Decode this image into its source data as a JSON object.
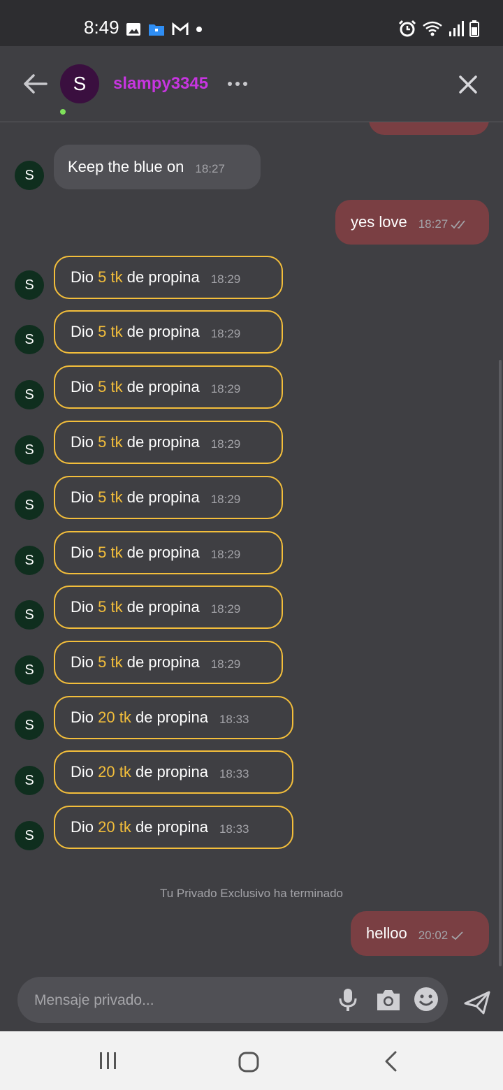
{
  "status_bar": {
    "time": "8:49"
  },
  "header": {
    "username": "slampy3345",
    "avatar_letter": "S"
  },
  "messages": [
    {
      "type": "in",
      "text": "Keep the blue on",
      "time": "18:27",
      "avatar": "S"
    },
    {
      "type": "out",
      "text": "yes love",
      "time": "18:27",
      "status": "read"
    },
    {
      "type": "tip",
      "prefix": "Dio",
      "amount": "5 tk",
      "suffix": "de propina",
      "time": "18:29",
      "avatar": "S"
    },
    {
      "type": "tip",
      "prefix": "Dio",
      "amount": "5 tk",
      "suffix": "de propina",
      "time": "18:29",
      "avatar": "S"
    },
    {
      "type": "tip",
      "prefix": "Dio",
      "amount": "5 tk",
      "suffix": "de propina",
      "time": "18:29",
      "avatar": "S"
    },
    {
      "type": "tip",
      "prefix": "Dio",
      "amount": "5 tk",
      "suffix": "de propina",
      "time": "18:29",
      "avatar": "S"
    },
    {
      "type": "tip",
      "prefix": "Dio",
      "amount": "5 tk",
      "suffix": "de propina",
      "time": "18:29",
      "avatar": "S"
    },
    {
      "type": "tip",
      "prefix": "Dio",
      "amount": "5 tk",
      "suffix": "de propina",
      "time": "18:29",
      "avatar": "S"
    },
    {
      "type": "tip",
      "prefix": "Dio",
      "amount": "5 tk",
      "suffix": "de propina",
      "time": "18:29",
      "avatar": "S"
    },
    {
      "type": "tip",
      "prefix": "Dio",
      "amount": "5 tk",
      "suffix": "de propina",
      "time": "18:29",
      "avatar": "S"
    },
    {
      "type": "tip",
      "prefix": "Dio",
      "amount": "20 tk",
      "suffix": "de propina",
      "time": "18:33",
      "avatar": "S"
    },
    {
      "type": "tip",
      "prefix": "Dio",
      "amount": "20 tk",
      "suffix": "de propina",
      "time": "18:33",
      "avatar": "S"
    },
    {
      "type": "tip",
      "prefix": "Dio",
      "amount": "20 tk",
      "suffix": "de propina",
      "time": "18:33",
      "avatar": "S"
    },
    {
      "type": "system",
      "text": "Tu Privado Exclusivo ha terminado"
    },
    {
      "type": "out",
      "text": "helloo",
      "time": "20:02",
      "status": "sent"
    }
  ],
  "composer": {
    "placeholder": "Mensaje privado..."
  },
  "colors": {
    "accent_username": "#c735e0",
    "tip_highlight": "#f3be3b",
    "outgoing_bubble": "#7a3f43",
    "incoming_bubble": "#505055",
    "background": "#3f3f43"
  },
  "icons": {
    "status_left": [
      "image-icon",
      "folder-icon",
      "gmail-icon",
      "dot-icon"
    ],
    "status_right": [
      "alarm-icon",
      "wifi-icon",
      "signal-icon",
      "battery-icon"
    ],
    "header": [
      "back-arrow-icon",
      "more-icon",
      "close-icon"
    ],
    "composer": [
      "mic-icon",
      "camera-icon",
      "emoji-icon",
      "send-icon"
    ],
    "nav": [
      "recent-apps-icon",
      "home-icon",
      "nav-back-icon"
    ]
  }
}
